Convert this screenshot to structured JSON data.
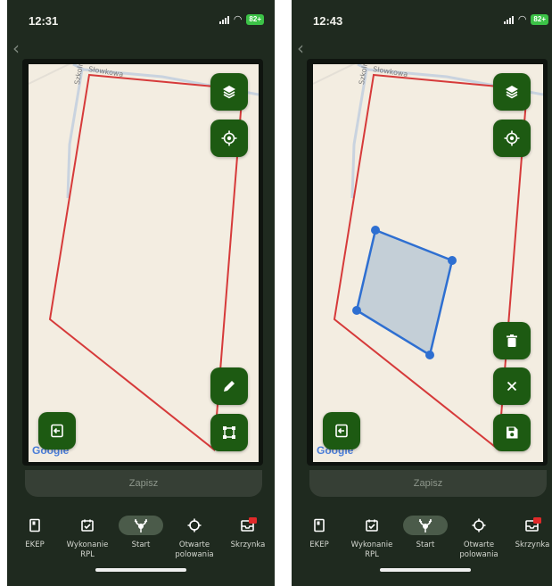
{
  "screens": [
    {
      "time": "12:31",
      "battery": "82+",
      "streets": {
        "horizontal": "Słowkowa",
        "vertical": "Szkolna"
      },
      "map_attribution": "Google",
      "save_label": "Zapisz"
    },
    {
      "time": "12:43",
      "battery": "82+",
      "streets": {
        "horizontal": "Słowkowa",
        "vertical": "Szkolna"
      },
      "map_attribution": "Google",
      "save_label": "Zapisz"
    }
  ],
  "nav": {
    "items": [
      {
        "label": "EKEP",
        "icon": "book-icon"
      },
      {
        "label": "Wykonanie RPL",
        "icon": "calendar-check-icon"
      },
      {
        "label": "Start",
        "icon": "antlers-icon",
        "active": true
      },
      {
        "label": "Otwarte polowania",
        "icon": "crosshair-icon"
      },
      {
        "label": "Skrzynka",
        "icon": "inbox-icon"
      }
    ]
  },
  "colors": {
    "accent_green": "#1d5a12",
    "boundary_red": "#d63a3a",
    "selection_blue": "#2e6fd1",
    "background": "#1f2a1f"
  }
}
